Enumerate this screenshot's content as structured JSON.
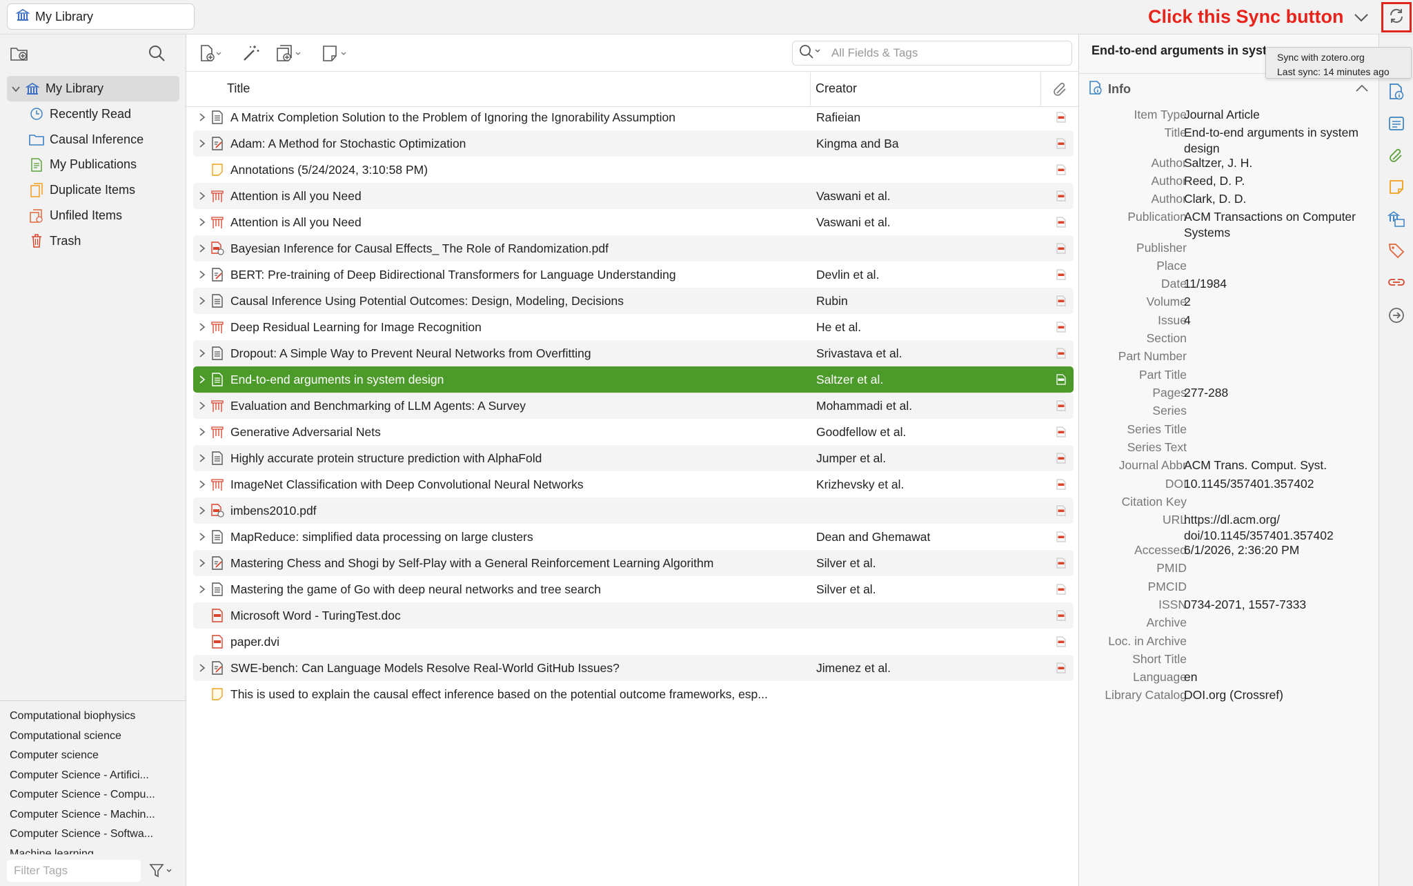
{
  "top": {
    "library_tab": "My Library",
    "instruction": "Click this Sync button",
    "tooltip_line1": "Sync with zotero.org",
    "tooltip_line2": "Last sync: 14 minutes ago"
  },
  "collections": [
    {
      "label": "My Library",
      "icon": "library-icon",
      "selected": true
    },
    {
      "label": "Recently Read",
      "icon": "clock-icon"
    },
    {
      "label": "Causal Inference",
      "icon": "folder-icon"
    },
    {
      "label": "My Publications",
      "icon": "publications-icon"
    },
    {
      "label": "Duplicate Items",
      "icon": "duplicate-icon"
    },
    {
      "label": "Unfiled Items",
      "icon": "unfiled-icon"
    },
    {
      "label": "Trash",
      "icon": "trash-icon"
    }
  ],
  "tags": [
    "Computational biophysics",
    "Computational science",
    "Computer science",
    "Computer Science - Artifici...",
    "Computer Science - Compu...",
    "Computer Science - Machin...",
    "Computer Science - Softwa...",
    "Machine learning"
  ],
  "tag_filter_placeholder": "Filter Tags",
  "search_placeholder": "All Fields & Tags",
  "columns": {
    "title": "Title",
    "creator": "Creator"
  },
  "items": [
    {
      "title": "A Matrix Completion Solution to the Problem of Ignoring the Ignorability Assumption",
      "creator": "Rafieian",
      "type": "doc",
      "expand": true
    },
    {
      "title": "Adam: A Method for Stochastic Optimization",
      "creator": "Kingma and Ba",
      "type": "preprint",
      "expand": true
    },
    {
      "title": "Annotations (5/24/2024, 3:10:58 PM)",
      "creator": "",
      "type": "note",
      "expand": false
    },
    {
      "title": "Attention is All you Need",
      "creator": "Vaswani et al.",
      "type": "conf",
      "expand": true
    },
    {
      "title": "Attention is All you Need",
      "creator": "Vaswani et al.",
      "type": "conf",
      "expand": true
    },
    {
      "title": "Bayesian Inference for Causal Effects_ The Role of Randomization.pdf",
      "creator": "",
      "type": "pdflink",
      "expand": true
    },
    {
      "title": "BERT: Pre-training of Deep Bidirectional Transformers for Language Understanding",
      "creator": "Devlin et al.",
      "type": "preprint",
      "expand": true
    },
    {
      "title": "Causal Inference Using Potential Outcomes: Design, Modeling, Decisions",
      "creator": "Rubin",
      "type": "doc",
      "expand": true
    },
    {
      "title": "Deep Residual Learning for Image Recognition",
      "creator": "He et al.",
      "type": "conf",
      "expand": true
    },
    {
      "title": "Dropout: A Simple Way to Prevent Neural Networks from Overfitting",
      "creator": "Srivastava et al.",
      "type": "doc",
      "expand": true
    },
    {
      "title": "End-to-end arguments in system design",
      "creator": "Saltzer et al.",
      "type": "doc",
      "expand": true,
      "selected": true
    },
    {
      "title": "Evaluation and Benchmarking of LLM Agents: A Survey",
      "creator": "Mohammadi et al.",
      "type": "conf",
      "expand": true
    },
    {
      "title": "Generative Adversarial Nets",
      "creator": "Goodfellow et al.",
      "type": "conf",
      "expand": true
    },
    {
      "title": "Highly accurate protein structure prediction with AlphaFold",
      "creator": "Jumper et al.",
      "type": "doc",
      "expand": true
    },
    {
      "title": "ImageNet Classification with Deep Convolutional Neural Networks",
      "creator": "Krizhevsky et al.",
      "type": "conf",
      "expand": true
    },
    {
      "title": "imbens2010.pdf",
      "creator": "",
      "type": "pdflink",
      "expand": true
    },
    {
      "title": "MapReduce: simplified data processing on large clusters",
      "creator": "Dean and Ghemawat",
      "type": "doc",
      "expand": true
    },
    {
      "title": "Mastering Chess and Shogi by Self-Play with a General Reinforcement Learning Algorithm",
      "creator": "Silver et al.",
      "type": "preprint",
      "expand": true
    },
    {
      "title": "Mastering the game of Go with deep neural networks and tree search",
      "creator": "Silver et al.",
      "type": "doc",
      "expand": true
    },
    {
      "title": "Microsoft Word - TuringTest.doc",
      "creator": "",
      "type": "pdf",
      "expand": false
    },
    {
      "title": "paper.dvi",
      "creator": "",
      "type": "pdf",
      "expand": false
    },
    {
      "title": "SWE-bench: Can Language Models Resolve Real-World GitHub Issues?",
      "creator": "Jimenez et al.",
      "type": "preprint",
      "expand": true
    },
    {
      "title": "This is used to explain the causal effect inference based on the potential outcome frameworks, esp...",
      "creator": "",
      "type": "note",
      "expand": false,
      "noatt": true
    }
  ],
  "detail": {
    "header": "End-to-end arguments in system design",
    "section": "Info",
    "fields": [
      {
        "label": "Item Type",
        "value": "Journal Article"
      },
      {
        "label": "Title",
        "value": "End-to-end arguments in system design"
      },
      {
        "label": "Author",
        "value": "Saltzer, J. H."
      },
      {
        "label": "Author",
        "value": "Reed, D. P."
      },
      {
        "label": "Author",
        "value": "Clark, D. D."
      },
      {
        "label": "Publication",
        "value": "ACM Transactions on Computer Systems"
      },
      {
        "label": "Publisher",
        "value": ""
      },
      {
        "label": "Place",
        "value": ""
      },
      {
        "label": "Date",
        "value": "11/1984"
      },
      {
        "label": "Volume",
        "value": "2"
      },
      {
        "label": "Issue",
        "value": "4"
      },
      {
        "label": "Section",
        "value": ""
      },
      {
        "label": "Part Number",
        "value": ""
      },
      {
        "label": "Part Title",
        "value": ""
      },
      {
        "label": "Pages",
        "value": "277-288"
      },
      {
        "label": "Series",
        "value": ""
      },
      {
        "label": "Series Title",
        "value": ""
      },
      {
        "label": "Series Text",
        "value": ""
      },
      {
        "label": "Journal Abbr",
        "value": "ACM Trans. Comput. Syst."
      },
      {
        "label": "DOI",
        "value": "10.1145/357401.357402"
      },
      {
        "label": "Citation Key",
        "value": ""
      },
      {
        "label": "URL",
        "value": "https://dl.acm.org/ doi/10.1145/357401.357402"
      },
      {
        "label": "Accessed",
        "value": "6/1/2026, 2:36:20 PM"
      },
      {
        "label": "PMID",
        "value": ""
      },
      {
        "label": "PMCID",
        "value": ""
      },
      {
        "label": "ISSN",
        "value": "0734-2071, 1557-7333"
      },
      {
        "label": "Archive",
        "value": ""
      },
      {
        "label": "Loc. in Archive",
        "value": ""
      },
      {
        "label": "Short Title",
        "value": ""
      },
      {
        "label": "Language",
        "value": "en"
      },
      {
        "label": "Library Catalog",
        "value": "DOI.org (Crossref)"
      }
    ]
  },
  "colors": {
    "accent": "#4c9a2a",
    "instruction": "#e8231b",
    "icon_blue": "#3b82c4",
    "icon_red": "#d9432c"
  }
}
